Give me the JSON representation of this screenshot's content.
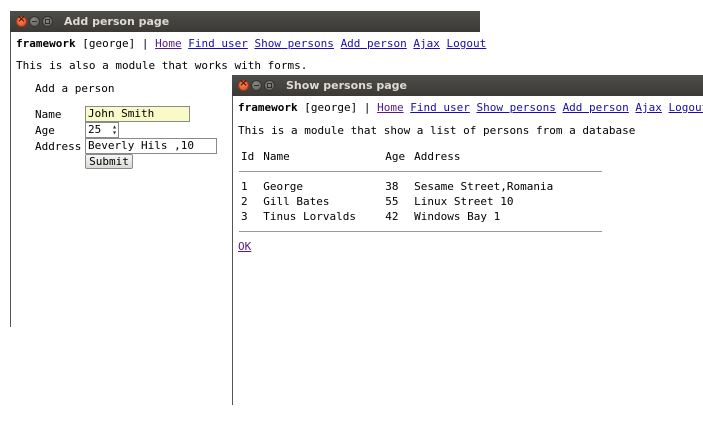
{
  "nav": {
    "brand": "framework",
    "user": "[george]",
    "separator": "|",
    "links": [
      "Home",
      "Find user",
      "Show persons",
      "Add person",
      "Ajax",
      "Logout"
    ]
  },
  "add_window": {
    "title": "Add person page",
    "intro": "This is also a module that works with forms.",
    "heading": "Add a person",
    "name_label": "Name",
    "name_value": "John Smith",
    "age_label": "Age",
    "age_value": "25",
    "age_stepper": "▲▼",
    "address_label": "Address",
    "address_value": "Beverly Hils ,10",
    "submit_label": "Submit"
  },
  "show_window": {
    "title": "Show persons page",
    "intro": "This is a module that show a list of persons from a database",
    "columns": [
      "Id",
      "Name",
      "Age",
      "Address"
    ],
    "rows": [
      [
        "1",
        "George",
        "38",
        "Sesame Street,Romania"
      ],
      [
        "2",
        "Gill Bates",
        "55",
        "Linux Street 10"
      ],
      [
        "3",
        "Tinus Lorvalds",
        "42",
        "Windows Bay 1"
      ]
    ],
    "ok_label": "OK"
  },
  "colors": {
    "titlebar": "#3b3a37",
    "title_text": "#dfdbd2",
    "link": "#1a0dab",
    "visited_link": "#551a8b",
    "field_highlight": "#fafac8",
    "close_button": "#e0491a"
  }
}
